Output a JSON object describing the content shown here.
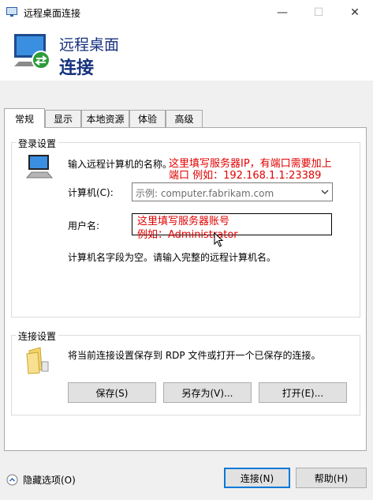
{
  "window": {
    "title": "远程桌面连接",
    "minimize_glyph": "—",
    "maximize_glyph": "☐",
    "close_glyph": "✕"
  },
  "header": {
    "line1": "远程桌面",
    "line2": "连接"
  },
  "tabs": [
    {
      "label": "常规",
      "active": true
    },
    {
      "label": "显示"
    },
    {
      "label": "本地资源"
    },
    {
      "label": "体验"
    },
    {
      "label": "高级"
    }
  ],
  "login": {
    "group_title": "登录设置",
    "prompt": "输入远程计算机的名称。",
    "computer_label": "计算机(C):",
    "computer_placeholder": "示例: computer.fabrikam.com",
    "user_label": "用户名:",
    "note": "计算机名字段为空。请输入完整的远程计算机名。",
    "annotation_computer_line1": "这里填写服务器IP，有端口需要加上",
    "annotation_computer_line2": "端口 例如：192.168.1.1:23389",
    "annotation_user_line1": "这里填写服务器账号",
    "annotation_user_line2": "例如：Administrator"
  },
  "connection": {
    "group_title": "连接设置",
    "description": "将当前连接设置保存到 RDP 文件或打开一个已保存的连接。",
    "save_label": "保存(S)",
    "save_as_label": "另存为(V)...",
    "open_label": "打开(E)..."
  },
  "footer": {
    "hide_options_label": "隐藏选项(O)",
    "connect_label": "连接(N)",
    "help_label": "帮助(H)"
  },
  "colors": {
    "accent": "#0078d7",
    "header_text": "#16327d",
    "annotation": "#e00000"
  }
}
